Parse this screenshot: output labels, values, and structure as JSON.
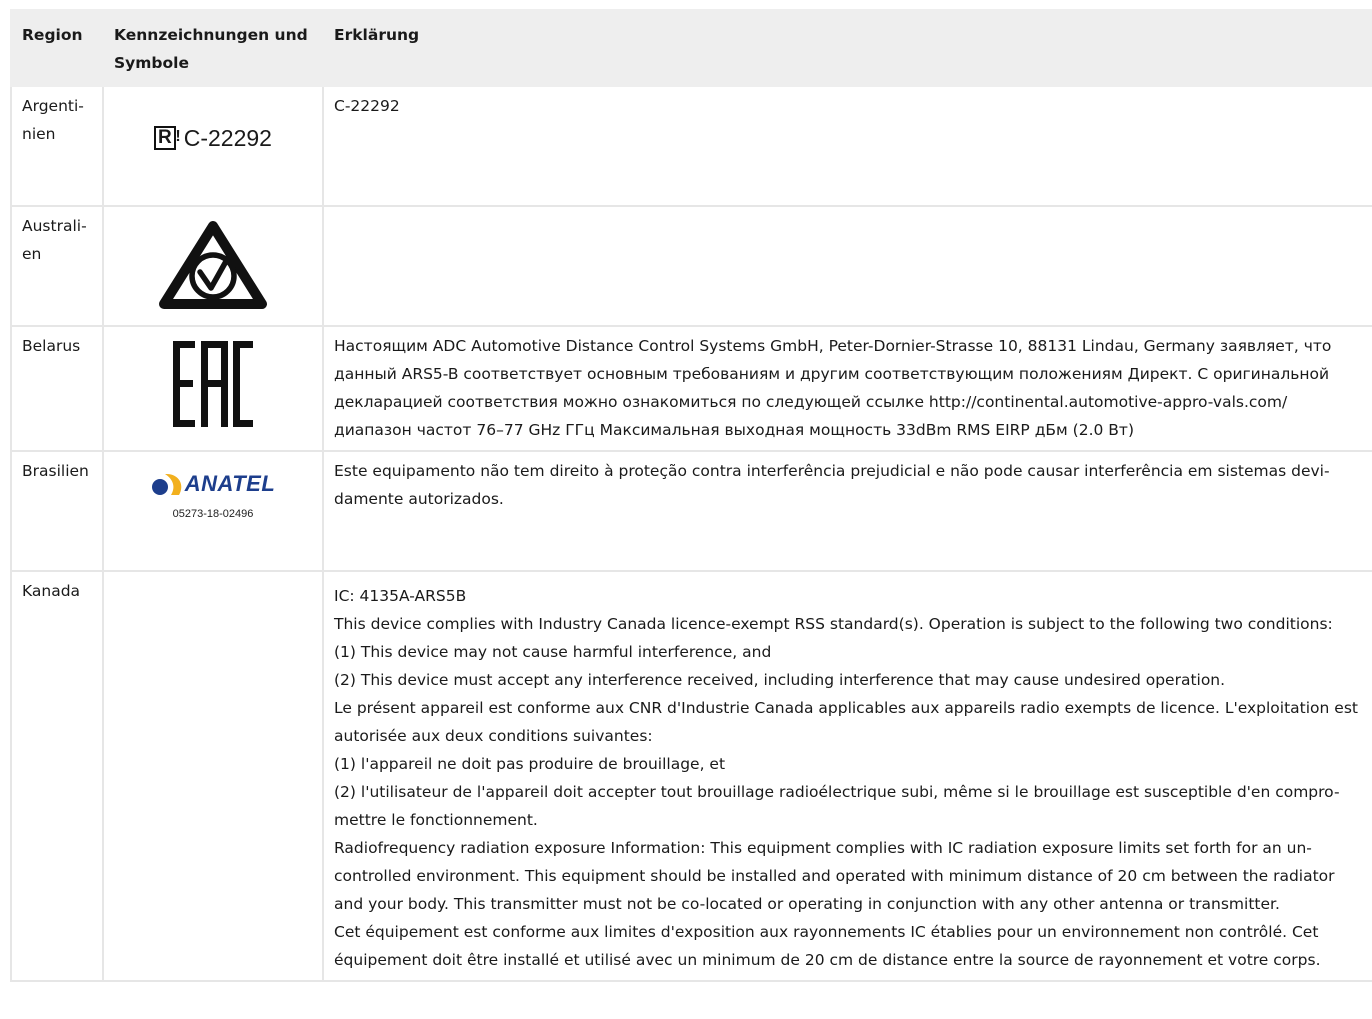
{
  "headers": {
    "region": "Region",
    "marks": "Kennzeichnungen und Symbole",
    "explanation": "Erklärung"
  },
  "rows": {
    "argentina": {
      "region": "Argenti-nien",
      "mark_code": "C-22292",
      "explanation": "C-22292"
    },
    "australia": {
      "region": "Australi-en",
      "mark": "rcm-icon"
    },
    "belarus": {
      "region": "Belarus",
      "mark": "eac-icon",
      "explanation": "Настоящим ADC Automotive Distance Control Systems GmbH, Peter-Dornier-Strasse 10, 88131 Lindau, Germany заявляет, что данный ARS5-B соответствует основным требованиям и другим соответствующим положениям Директ. С оригинальной декларацией соответствия можно ознакомиться по следующей ссылке http://continental.automotive-appro-vals.com/ диапазон частот 76–77 GHz ГГц Максимальная выходная мощность 33dBm RMS EIRP дБм (2.0 Вт)"
    },
    "brazil": {
      "region": "Brasilien",
      "mark_word": "ANATEL",
      "mark_number": "05273-18-02496",
      "explanation": "Este equipamento não tem direito à proteção contra interferência prejudicial e não pode causar interferência em sistemas devi-damente autorizados."
    },
    "canada": {
      "region": "Kanada",
      "paragraphs": [
        "IC: 4135A-ARS5B",
        "This device complies with Industry Canada licence-exempt RSS standard(s). Operation is subject to the following two conditions:",
        "(1) This device may not cause harmful interference, and",
        "(2) This device must accept any interference received, including interference that may cause undesired operation.",
        "Le présent appareil est conforme aux CNR d'Industrie Canada applicables aux appareils radio exempts de licence. L'exploitation est autorisée aux deux conditions suivantes:",
        "(1) l'appareil ne doit pas produire de brouillage, et",
        "(2) l'utilisateur de l'appareil doit accepter tout brouillage radioélectrique subi, même si le brouillage est susceptible d'en compro-mettre le fonctionnement.",
        "Radiofrequency radiation exposure Information: This equipment complies with IC radiation exposure limits set forth for an un-controlled environment. This equipment should be installed and operated with minimum distance of 20 cm between the radiator and your body. This transmitter must not be co-located or operating in conjunction with any other antenna or transmitter.",
        "Cet équipement est conforme aux limites d'exposition aux rayonnements IC établies pour un environnement non contrôlé. Cet équipement doit être installé et utilisé avec un minimum de 20 cm de distance entre la source de rayonnement et votre corps."
      ]
    }
  },
  "colors": {
    "header_bg": "#eeeeee",
    "grid": "#e6e6e6",
    "anatel_blue": "#1d3e8c",
    "anatel_gold": "#f2b01e"
  }
}
